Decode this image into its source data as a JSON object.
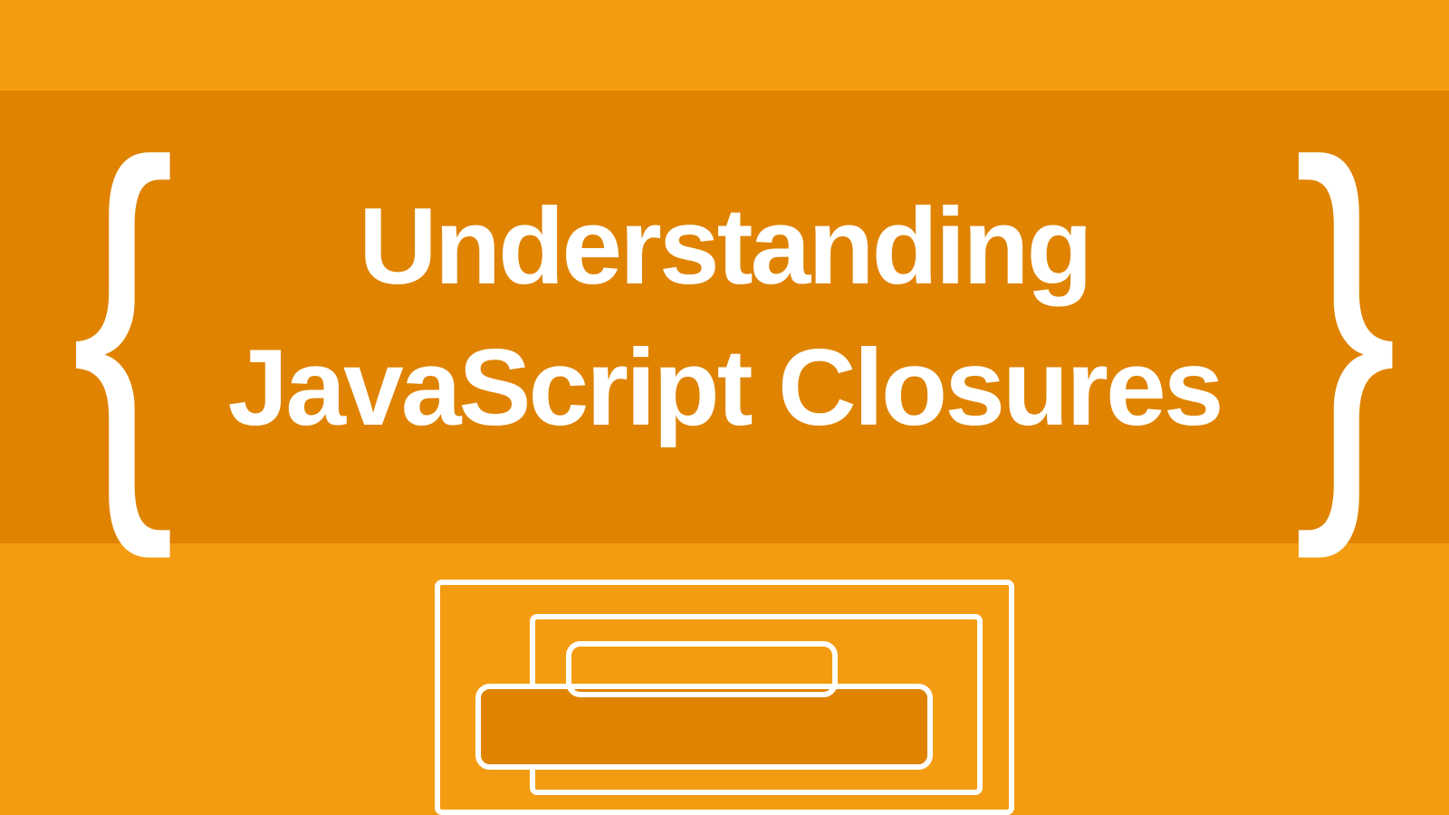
{
  "title": {
    "line1": "Understanding",
    "line2": "JavaScript Closures"
  },
  "glyphs": {
    "left_brace": "{",
    "right_brace": "}"
  },
  "colors": {
    "background": "#f39c12",
    "band": "#e08300",
    "foreground": "#ffffff"
  }
}
